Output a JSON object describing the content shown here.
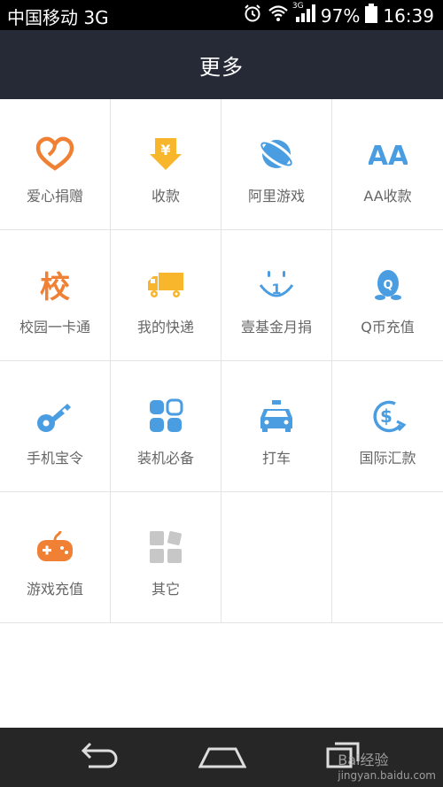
{
  "status_bar": {
    "carrier": "中国移动 3G",
    "network": "3G",
    "battery": "97%",
    "time": "16:39"
  },
  "header": {
    "title": "更多"
  },
  "grid": [
    [
      {
        "label": "爱心捐赠",
        "icon": "heart-icon"
      },
      {
        "label": "收款",
        "icon": "yen-download-icon"
      },
      {
        "label": "阿里游戏",
        "icon": "planet-icon"
      },
      {
        "label": "AA收款",
        "icon": "aa-icon"
      }
    ],
    [
      {
        "label": "校园一卡通",
        "icon": "campus-icon"
      },
      {
        "label": "我的快递",
        "icon": "truck-icon"
      },
      {
        "label": "壹基金月捐",
        "icon": "smile-one-icon"
      },
      {
        "label": "Q币充值",
        "icon": "penguin-icon"
      }
    ],
    [
      {
        "label": "手机宝令",
        "icon": "key-icon"
      },
      {
        "label": "装机必备",
        "icon": "apps-icon"
      },
      {
        "label": "打车",
        "icon": "taxi-icon"
      },
      {
        "label": "国际汇款",
        "icon": "dollar-globe-icon"
      }
    ],
    [
      {
        "label": "游戏充值",
        "icon": "gamepad-icon"
      },
      {
        "label": "其它",
        "icon": "other-grid-icon"
      }
    ]
  ],
  "colors": {
    "header_bg": "#252a36",
    "orange": "#f08033",
    "yellow": "#f7b62b",
    "blue": "#4a9de0",
    "gray_icon": "#c7c7c7"
  },
  "watermark": {
    "line1": "Bai经验",
    "line2": "jingyan.baidu.com"
  }
}
